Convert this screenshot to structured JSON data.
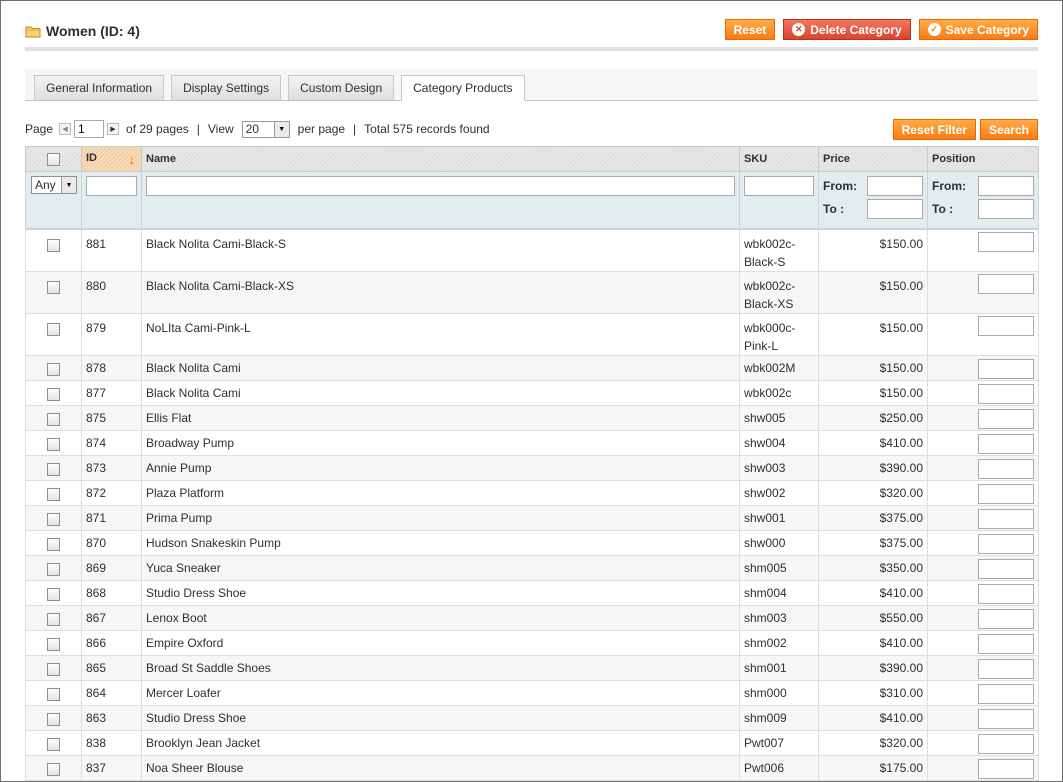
{
  "header": {
    "title": "Women (ID: 4)",
    "buttons": {
      "reset": "Reset",
      "delete": "Delete Category",
      "save": "Save Category"
    },
    "icons": [
      "folder-icon",
      "delete-icon",
      "check-icon"
    ]
  },
  "tabs": [
    {
      "label": "General Information",
      "active": false
    },
    {
      "label": "Display Settings",
      "active": false
    },
    {
      "label": "Custom Design",
      "active": false
    },
    {
      "label": "Category Products",
      "active": true
    }
  ],
  "pager": {
    "page_label": "Page",
    "page_value": "1",
    "of_pages": "of 29 pages",
    "view_label": "View",
    "per_page_value": "20",
    "per_page_label": "per page",
    "total": "Total 575 records found",
    "reset_filter": "Reset Filter",
    "search": "Search"
  },
  "grid": {
    "columns": {
      "id": "ID",
      "name": "Name",
      "sku": "SKU",
      "price": "Price",
      "position": "Position"
    },
    "filter": {
      "any": "Any",
      "from": "From:",
      "to": "To :"
    },
    "rows": [
      {
        "id": "881",
        "name": "Black Nolita Cami-Black-S",
        "sku": "wbk002c-Black-S",
        "price": "$150.00"
      },
      {
        "id": "880",
        "name": "Black Nolita Cami-Black-XS",
        "sku": "wbk002c-Black-XS",
        "price": "$150.00"
      },
      {
        "id": "879",
        "name": "NoLIta Cami-Pink-L",
        "sku": "wbk000c-Pink-L",
        "price": "$150.00"
      },
      {
        "id": "878",
        "name": "Black Nolita Cami",
        "sku": "wbk002M",
        "price": "$150.00"
      },
      {
        "id": "877",
        "name": "Black Nolita Cami",
        "sku": "wbk002c",
        "price": "$150.00"
      },
      {
        "id": "875",
        "name": "Ellis Flat",
        "sku": "shw005",
        "price": "$250.00"
      },
      {
        "id": "874",
        "name": "Broadway Pump",
        "sku": "shw004",
        "price": "$410.00"
      },
      {
        "id": "873",
        "name": "Annie Pump",
        "sku": "shw003",
        "price": "$390.00"
      },
      {
        "id": "872",
        "name": "Plaza Platform",
        "sku": "shw002",
        "price": "$320.00"
      },
      {
        "id": "871",
        "name": "Prima Pump",
        "sku": "shw001",
        "price": "$375.00"
      },
      {
        "id": "870",
        "name": "Hudson Snakeskin Pump",
        "sku": "shw000",
        "price": "$375.00"
      },
      {
        "id": "869",
        "name": "Yuca Sneaker",
        "sku": "shm005",
        "price": "$350.00"
      },
      {
        "id": "868",
        "name": "Studio Dress Shoe",
        "sku": "shm004",
        "price": "$410.00"
      },
      {
        "id": "867",
        "name": "Lenox Boot",
        "sku": "shm003",
        "price": "$550.00"
      },
      {
        "id": "866",
        "name": "Empire Oxford",
        "sku": "shm002",
        "price": "$410.00"
      },
      {
        "id": "865",
        "name": "Broad St Saddle Shoes",
        "sku": "shm001",
        "price": "$390.00"
      },
      {
        "id": "864",
        "name": "Mercer Loafer",
        "sku": "shm000",
        "price": "$310.00"
      },
      {
        "id": "863",
        "name": "Studio Dress Shoe",
        "sku": "shm009",
        "price": "$410.00"
      },
      {
        "id": "838",
        "name": "Brooklyn Jean Jacket",
        "sku": "Pwt007",
        "price": "$320.00"
      },
      {
        "id": "837",
        "name": "Noa Sheer Blouse",
        "sku": "Pwt006",
        "price": "$175.00"
      }
    ]
  },
  "colors": {
    "accent": "#f77c16",
    "danger": "#d9452e",
    "filter_bg": "#e3edef"
  }
}
